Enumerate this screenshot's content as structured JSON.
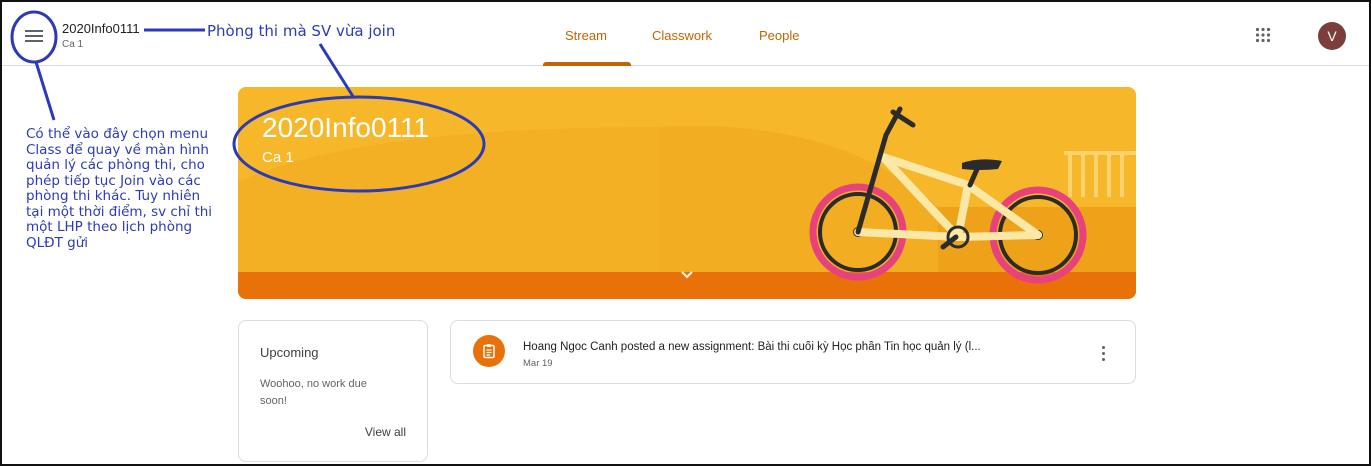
{
  "header": {
    "class_title": "2020Info0111",
    "class_section": "Ca 1",
    "tabs": [
      "Stream",
      "Classwork",
      "People"
    ],
    "avatar_initial": "V",
    "menu_icon": "hamburger-menu-icon",
    "apps_icon": "google-apps-grid-icon"
  },
  "annotations": {
    "top": "Phòng thi mà SV vừa join",
    "left": "Có thể vào đây chọn menu Class để quay về màn hình quản lý các phòng thi, cho phép tiếp tục Join vào các phòng thi khác. Tuy nhiên tại một thời điểm, sv chỉ thi một LHP theo lịch phòng QLĐT gửi"
  },
  "banner": {
    "title": "2020Info0111",
    "subtitle": "Ca 1",
    "expand_icon": "chevron-down-icon"
  },
  "upcoming": {
    "title": "Upcoming",
    "text": "Woohoo, no work due soon!",
    "view_all": "View all"
  },
  "post": {
    "text": "Hoang Ngoc Canh posted a new assignment: Bài thi cuối kỳ Học phần Tin học quản lý (l...",
    "date": "Mar 19",
    "icon": "assignment-icon",
    "more_icon": "more-vert-icon"
  },
  "colors": {
    "accent": "#c26401",
    "banner_bg": "#f6b82a",
    "banner_dark": "#e8710a",
    "annotation": "#2b3bb8",
    "avatar_bg": "#7c3e3a"
  }
}
